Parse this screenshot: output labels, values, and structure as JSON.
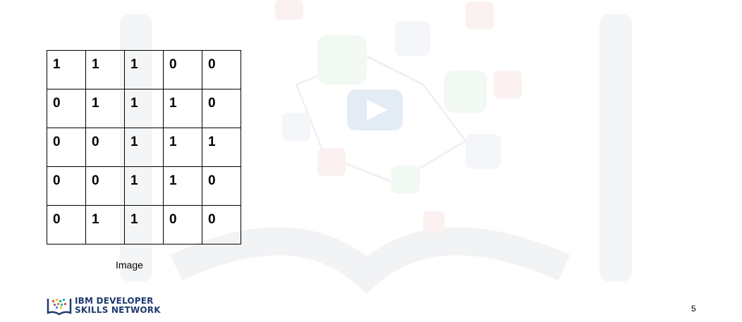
{
  "grid": {
    "rows": [
      [
        "1",
        "1",
        "1",
        "0",
        "0"
      ],
      [
        "0",
        "1",
        "1",
        "1",
        "0"
      ],
      [
        "0",
        "0",
        "1",
        "1",
        "1"
      ],
      [
        "0",
        "0",
        "1",
        "1",
        "0"
      ],
      [
        "0",
        "1",
        "1",
        "0",
        "0"
      ]
    ]
  },
  "caption": "Image",
  "logo": {
    "line1": "IBM DEVELOPER",
    "line2": "SKILLS NETWORK"
  },
  "page_number": "5",
  "video": {
    "icon": "play-icon"
  },
  "colors": {
    "logo_text": "#1f3a6e",
    "watermark": "#f3f4f6",
    "play_button": "#e3ecf4"
  }
}
